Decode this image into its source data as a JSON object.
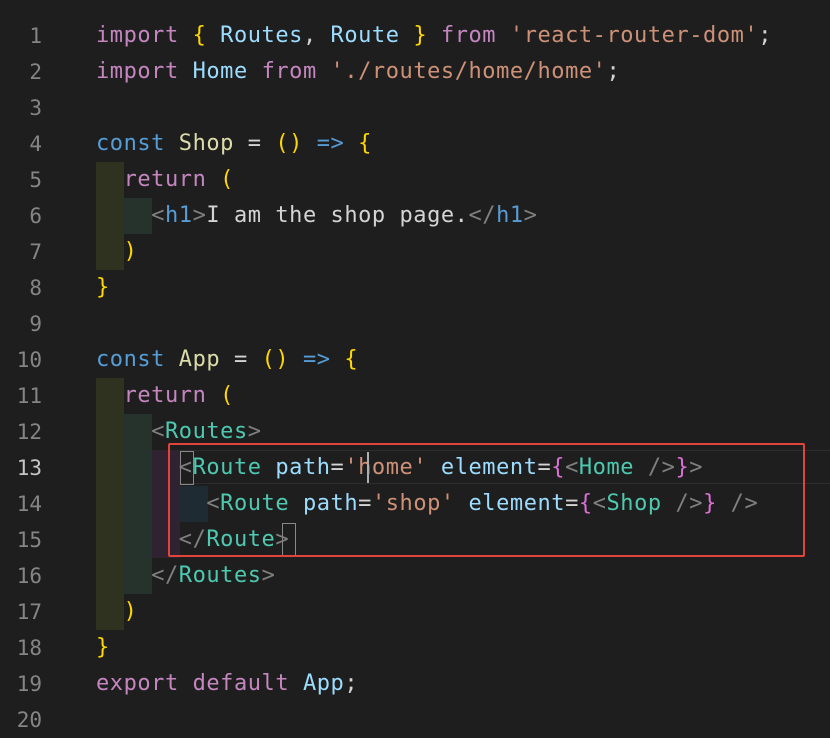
{
  "editor": {
    "language": "javascript",
    "active_line": 13,
    "highlight_box_lines": [
      13,
      15
    ],
    "theme_colors": {
      "background": "#1e1e1e",
      "keyword": "#c586c0",
      "storage": "#569cd6",
      "identifier": "#9cdcfe",
      "string": "#ce9178",
      "function_name": "#dcdcaa",
      "jsx_tag": "#4ec9b0",
      "punctuation": "#d4d4d4",
      "bracket_yellow": "#ffd700",
      "bracket_purple": "#da70d6",
      "bracket_blue": "#179fff",
      "highlight_border": "#e0443a"
    },
    "lines": [
      {
        "n": "1",
        "tokens": [
          [
            "kw",
            "import"
          ],
          [
            "p",
            " "
          ],
          [
            "by",
            "{"
          ],
          [
            "p",
            " "
          ],
          [
            "var",
            "Routes"
          ],
          [
            "p",
            ", "
          ],
          [
            "var",
            "Route"
          ],
          [
            "p",
            " "
          ],
          [
            "by",
            "}"
          ],
          [
            "p",
            " "
          ],
          [
            "kw",
            "from"
          ],
          [
            "p",
            " "
          ],
          [
            "str",
            "'react-router-dom'"
          ],
          [
            "p",
            ";"
          ]
        ]
      },
      {
        "n": "2",
        "tokens": [
          [
            "kw",
            "import"
          ],
          [
            "p",
            " "
          ],
          [
            "var",
            "Home"
          ],
          [
            "p",
            " "
          ],
          [
            "kw",
            "from"
          ],
          [
            "p",
            " "
          ],
          [
            "str",
            "'./routes/home/home'"
          ],
          [
            "p",
            ";"
          ]
        ]
      },
      {
        "n": "3",
        "tokens": []
      },
      {
        "n": "4",
        "tokens": [
          [
            "st",
            "const"
          ],
          [
            "p",
            " "
          ],
          [
            "fn",
            "Shop"
          ],
          [
            "p",
            " = "
          ],
          [
            "by",
            "()"
          ],
          [
            "p",
            " "
          ],
          [
            "st",
            "=>"
          ],
          [
            "p",
            " "
          ],
          [
            "by",
            "{"
          ]
        ]
      },
      {
        "n": "5",
        "tokens": [
          [
            "p",
            "  "
          ],
          [
            "kw",
            "return"
          ],
          [
            "p",
            " "
          ],
          [
            "by",
            "("
          ]
        ]
      },
      {
        "n": "6",
        "tokens": [
          [
            "p",
            "    "
          ],
          [
            "tp",
            "<"
          ],
          [
            "tag",
            "h1"
          ],
          [
            "tp",
            ">"
          ],
          [
            "p",
            "I am the shop page."
          ],
          [
            "tp",
            "</"
          ],
          [
            "tag",
            "h1"
          ],
          [
            "tp",
            ">"
          ]
        ]
      },
      {
        "n": "7",
        "tokens": [
          [
            "p",
            "  "
          ],
          [
            "by",
            ")"
          ]
        ]
      },
      {
        "n": "8",
        "tokens": [
          [
            "by",
            "}"
          ]
        ]
      },
      {
        "n": "9",
        "tokens": []
      },
      {
        "n": "10",
        "tokens": [
          [
            "st",
            "const"
          ],
          [
            "p",
            " "
          ],
          [
            "fn",
            "App"
          ],
          [
            "p",
            " = "
          ],
          [
            "by",
            "()"
          ],
          [
            "p",
            " "
          ],
          [
            "st",
            "=>"
          ],
          [
            "p",
            " "
          ],
          [
            "by",
            "{"
          ]
        ]
      },
      {
        "n": "11",
        "tokens": [
          [
            "p",
            "  "
          ],
          [
            "kw",
            "return"
          ],
          [
            "p",
            " "
          ],
          [
            "by",
            "("
          ]
        ]
      },
      {
        "n": "12",
        "tokens": [
          [
            "p",
            "    "
          ],
          [
            "tp",
            "<"
          ],
          [
            "jsx",
            "Routes"
          ],
          [
            "tp",
            ">"
          ]
        ]
      },
      {
        "n": "13",
        "tokens": [
          [
            "p",
            "      "
          ],
          [
            "tp",
            "<"
          ],
          [
            "jsx",
            "Route"
          ],
          [
            "p",
            " "
          ],
          [
            "var",
            "path"
          ],
          [
            "p",
            "="
          ],
          [
            "str",
            "'home'"
          ],
          [
            "p",
            " "
          ],
          [
            "var",
            "element"
          ],
          [
            "p",
            "="
          ],
          [
            "bp",
            "{"
          ],
          [
            "tp",
            "<"
          ],
          [
            "jsx",
            "Home"
          ],
          [
            "p",
            " "
          ],
          [
            "tp",
            "/>"
          ],
          [
            "bp",
            "}"
          ],
          [
            "tp",
            ">"
          ]
        ]
      },
      {
        "n": "14",
        "tokens": [
          [
            "p",
            "        "
          ],
          [
            "tp",
            "<"
          ],
          [
            "jsx",
            "Route"
          ],
          [
            "p",
            " "
          ],
          [
            "var",
            "path"
          ],
          [
            "p",
            "="
          ],
          [
            "str",
            "'shop'"
          ],
          [
            "p",
            " "
          ],
          [
            "var",
            "element"
          ],
          [
            "p",
            "="
          ],
          [
            "bp",
            "{"
          ],
          [
            "tp",
            "<"
          ],
          [
            "jsx",
            "Shop"
          ],
          [
            "p",
            " "
          ],
          [
            "tp",
            "/>"
          ],
          [
            "bp",
            "}"
          ],
          [
            "p",
            " "
          ],
          [
            "tp",
            "/>"
          ]
        ]
      },
      {
        "n": "15",
        "tokens": [
          [
            "p",
            "      "
          ],
          [
            "tp",
            "</"
          ],
          [
            "jsx",
            "Route"
          ],
          [
            "tp",
            ">"
          ]
        ]
      },
      {
        "n": "16",
        "tokens": [
          [
            "p",
            "    "
          ],
          [
            "tp",
            "</"
          ],
          [
            "jsx",
            "Routes"
          ],
          [
            "tp",
            ">"
          ]
        ]
      },
      {
        "n": "17",
        "tokens": [
          [
            "p",
            "  "
          ],
          [
            "by",
            ")"
          ]
        ]
      },
      {
        "n": "18",
        "tokens": [
          [
            "by",
            "}"
          ]
        ]
      },
      {
        "n": "19",
        "tokens": [
          [
            "kw",
            "export"
          ],
          [
            "p",
            " "
          ],
          [
            "kw",
            "default"
          ],
          [
            "p",
            " "
          ],
          [
            "var",
            "App"
          ],
          [
            "p",
            ";"
          ]
        ]
      },
      {
        "n": "20",
        "tokens": []
      }
    ]
  }
}
